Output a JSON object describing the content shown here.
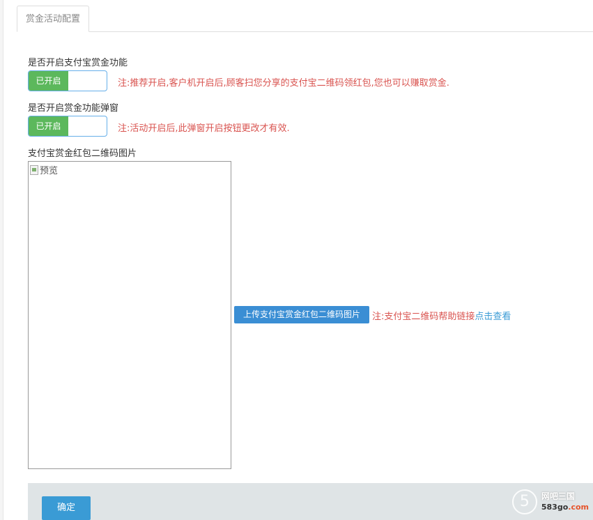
{
  "tabs": [
    {
      "label": "赏金活动配置"
    }
  ],
  "alipay_bounty": {
    "label": "是否开启支付宝赏金功能",
    "switch_label": "已开启",
    "note": "注:推荐开启,客户机开启后,顾客扫您分享的支付宝二维码领红包,您也可以赚取赏金."
  },
  "bounty_popup": {
    "label": "是否开启赏金功能弹窗",
    "switch_label": "已开启",
    "note": "注:活动开启后,此弹窗开启按钮更改才有效."
  },
  "qr_image": {
    "label": "支付宝赏金红包二维码图片",
    "preview_alt": "预览",
    "upload_label": "上传支付宝赏金红包二维码图片",
    "note_prefix": "注:支付宝二维码帮助链接",
    "note_link": "点击查看"
  },
  "footer": {
    "confirm_label": "确定"
  },
  "watermark": {
    "name": "网吧三国",
    "url_main": "583go",
    "url_suffix": ".com",
    "logo_glyph": "5"
  },
  "colors": {
    "switch_on": "#5cb85c",
    "note_red": "#d9534f",
    "primary_blue": "#3a8ed4",
    "link_blue": "#3a9bd5"
  }
}
